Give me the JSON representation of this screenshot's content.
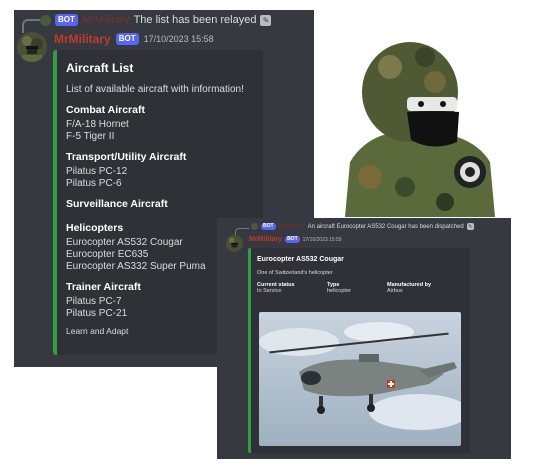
{
  "main_message": {
    "reply": {
      "bot_tag": "BOT",
      "username": "MrMilitary",
      "text": "The list has been relayed"
    },
    "username": "MrMilitary",
    "bot_tag": "BOT",
    "timestamp": "17/10/2023 15:58",
    "embed": {
      "title": "Aircraft List",
      "description": "List of available aircraft with information!",
      "accent_color": "#2ea043",
      "sections": [
        {
          "title": "Combat Aircraft",
          "items": [
            "F/A-18 Hornet",
            "F-5 Tiger II"
          ]
        },
        {
          "title": "Transport/Utility Aircraft",
          "items": [
            "Pilatus PC-12",
            "Pilatus PC-6"
          ]
        },
        {
          "title": "Surveillance Aircraft",
          "items": []
        },
        {
          "title": "Helicopters",
          "items": [
            "Eurocopter AS532 Cougar",
            "Eurocopter EC635",
            "Eurocopter AS332 Super Puma"
          ]
        },
        {
          "title": "Trainer Aircraft",
          "items": [
            "Pilatus PC-7",
            "Pilatus PC-21"
          ]
        }
      ],
      "footer": "Learn and Adapt"
    }
  },
  "dispatch_message": {
    "reply": {
      "bot_tag": "BOT",
      "username": "MrMilitary",
      "text": "An aircraft Eurocopter AS532 Cougar has been dispatched"
    },
    "username": "MrMilitary",
    "bot_tag": "BOT",
    "timestamp": "17/10/2023 15:59",
    "embed": {
      "title": "Eurocopter AS532 Cougar",
      "description": "One of Switzerland's helicopter",
      "fields": [
        {
          "name": "Current status",
          "value": "In Service"
        },
        {
          "name": "Type",
          "value": "helicopter"
        },
        {
          "name": "Manufactured by",
          "value": "Airbus"
        }
      ]
    }
  },
  "colors": {
    "background": "#36393f",
    "embed_bg": "#2f3136",
    "accent": "#2ea043",
    "username": "#c03a2b",
    "bot_tag": "#5865f2"
  }
}
